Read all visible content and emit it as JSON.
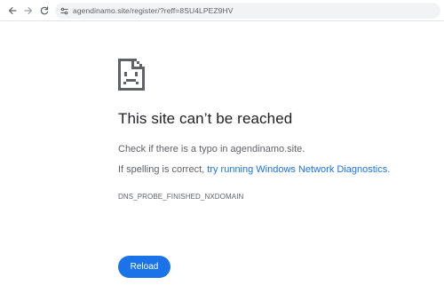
{
  "browser": {
    "url": "agendinamo.site/register/?reff=8SU4LPEZ9HV",
    "icons": {
      "back": "arrow-left-icon",
      "forward": "arrow-right-icon",
      "reload": "reload-icon",
      "site_info": "site-info-icon"
    }
  },
  "error_page": {
    "icon": "sad-document-icon",
    "title": "This site can’t be reached",
    "check_text": "Check if there is a typo in agendinamo.site.",
    "spelling_prefix": "If spelling is correct, ",
    "diagnostics_link": "try running Windows Network Diagnostics",
    "spelling_suffix": ".",
    "error_code": "DNS_PROBE_FINISHED_NXDOMAIN",
    "reload_label": "Reload"
  },
  "colors": {
    "link": "#1a73e8",
    "button": "#1a73e8",
    "heading": "#202124",
    "body_text": "#5f6368"
  }
}
